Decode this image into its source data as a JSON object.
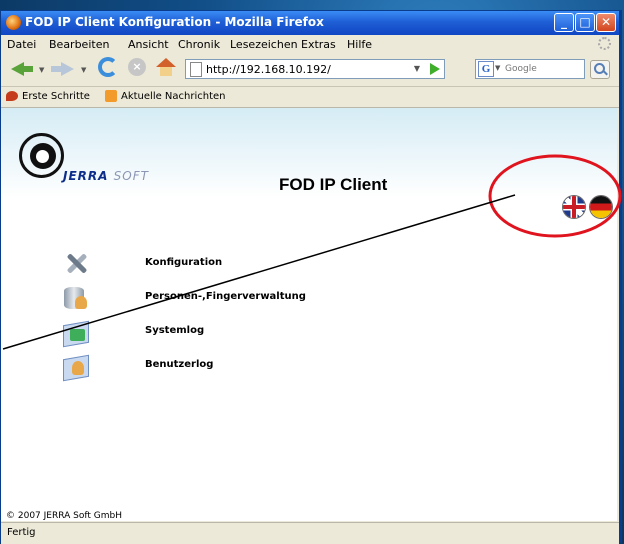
{
  "window": {
    "title": "FOD IP Client Konfiguration - Mozilla Firefox",
    "min": "_",
    "max": "□",
    "close": "✕"
  },
  "menubar": [
    "Datei",
    "Bearbeiten",
    "Ansicht",
    "Chronik",
    "Lesezeichen",
    "Extras",
    "Hilfe"
  ],
  "nav": {
    "url": "http://192.168.10.192/",
    "search_placeholder": "Google",
    "search_engine": "G",
    "stop": "×"
  },
  "bookmarks": [
    "Erste Schritte",
    "Aktuelle Nachrichten"
  ],
  "page": {
    "logo_brand": "JERRA",
    "logo_suffix": "SOFT",
    "title": "FOD IP Client",
    "languages": [
      "english",
      "deutsch"
    ],
    "menu": [
      {
        "label": "Konfiguration",
        "icon": "tools-icon"
      },
      {
        "label": "Personen-,Fingerverwaltung",
        "icon": "database-user-icon"
      },
      {
        "label": "Systemlog",
        "icon": "systemlog-icon"
      },
      {
        "label": "Benutzerlog",
        "icon": "userlog-icon"
      }
    ],
    "footer": "© 2007 JERRA Soft GmbH"
  },
  "status": "Fertig",
  "annotation_color": "#e0141e"
}
